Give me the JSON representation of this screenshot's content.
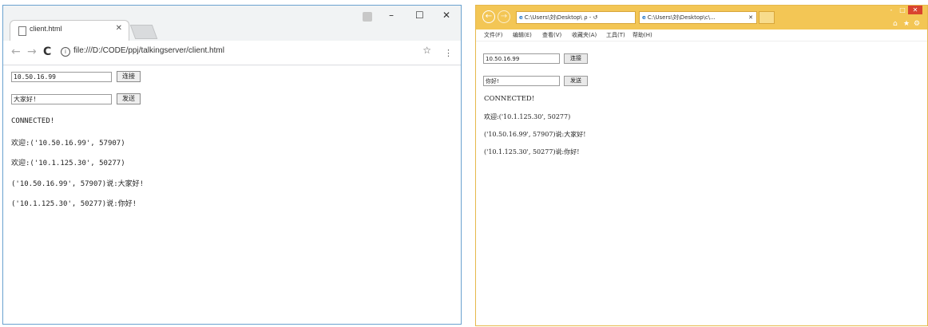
{
  "chrome": {
    "tab_title": "client.html",
    "url": "file:///D:/CODE/ppj/talkingserver/client.html",
    "window_controls": [
      "–",
      "☐",
      "✕"
    ],
    "server_ip": "10.50.16.99",
    "connect_label": "连接",
    "message": "大家好!",
    "send_label": "发送",
    "log": [
      "CONNECTED!",
      "欢迎:('10.50.16.99', 57907)",
      "欢迎:('10.1.125.30', 50277)",
      "('10.50.16.99', 57907)说:大家好!",
      "('10.1.125.30', 50277)说:你好!"
    ]
  },
  "ie": {
    "address": "C:\\Users\\刘\\Desktop\\ ρ - ↺",
    "tab_title": "C:\\Users\\刘\\Desktop\\c\\...",
    "window_controls": [
      "-",
      "□",
      "✕"
    ],
    "menu": [
      "文件(F)",
      "编辑(E)",
      "查看(V)",
      "收藏夹(A)",
      "工具(T)",
      "帮助(H)"
    ],
    "server_ip": "10.50.16.99",
    "connect_label": "连接",
    "message": "你好!",
    "send_label": "发送",
    "log": [
      "CONNECTED!",
      "欢迎:('10.1.125.30', 50277)",
      "('10.50.16.99', 57907)说:大家好!",
      "('10.1.125.30', 50277)说:你好!"
    ]
  }
}
